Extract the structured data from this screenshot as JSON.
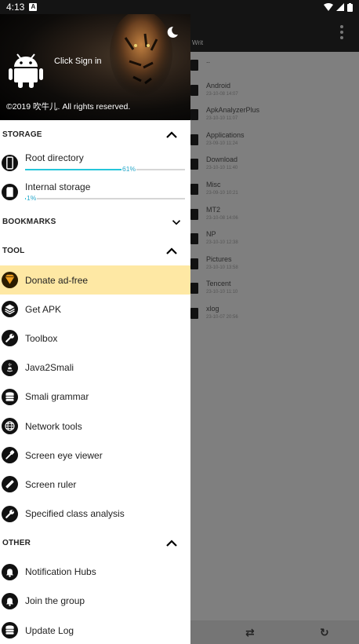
{
  "status_bar": {
    "time": "4:13",
    "notif": "A"
  },
  "background": {
    "path_label": "Writ",
    "files": [
      {
        "name": "..",
        "date": ""
      },
      {
        "name": "Android",
        "date": "23-10-08 14:07"
      },
      {
        "name": "ApkAnalyzerPlus",
        "date": "23-10-10 11:07"
      },
      {
        "name": "Applications",
        "date": "23-09-10 11:24"
      },
      {
        "name": "Download",
        "date": "23-10-10 11:40"
      },
      {
        "name": "Misc",
        "date": "23-09-10 10:21"
      },
      {
        "name": "MT2",
        "date": "23-10-08 14:06"
      },
      {
        "name": "NP",
        "date": "23-10-10 12:38"
      },
      {
        "name": "Pictures",
        "date": "23-10-10 13:58"
      },
      {
        "name": "Tencent",
        "date": "23-10-10 11:10"
      },
      {
        "name": "xlog",
        "date": "23-10-07 20:56"
      }
    ]
  },
  "header": {
    "signin": "Click Sign in",
    "copyright": "©2019 吹牛儿. All rights reserved."
  },
  "sections": {
    "storage": "STORAGE",
    "bookmarks": "BOOKMARKS",
    "tool": "TOOL",
    "other": "OTHER"
  },
  "storage": [
    {
      "label": "Root directory",
      "percent": 61,
      "percent_label": "61%"
    },
    {
      "label": "Internal storage",
      "percent": 1,
      "percent_label": "1%"
    }
  ],
  "tools": [
    {
      "label": "Donate ad-free",
      "icon": "diamond-icon",
      "highlighted": true
    },
    {
      "label": "Get APK",
      "icon": "layers-icon"
    },
    {
      "label": "Toolbox",
      "icon": "wrench-icon"
    },
    {
      "label": "Java2Smali",
      "icon": "java-icon"
    },
    {
      "label": "Smali grammar",
      "icon": "database-icon"
    },
    {
      "label": "Network tools",
      "icon": "globe-icon"
    },
    {
      "label": "Screen eye viewer",
      "icon": "eyedropper-icon"
    },
    {
      "label": "Screen ruler",
      "icon": "ruler-icon"
    },
    {
      "label": "Specified class analysis",
      "icon": "wrench-icon"
    }
  ],
  "other": [
    {
      "label": "Notification Hubs",
      "icon": "bell-icon"
    },
    {
      "label": "Join the group",
      "icon": "bell-icon"
    },
    {
      "label": "Update Log",
      "icon": "database-icon"
    }
  ],
  "colors": {
    "accent": "#26c6da",
    "highlight": "#fee8a4",
    "scrim": "#7f7f7f"
  }
}
